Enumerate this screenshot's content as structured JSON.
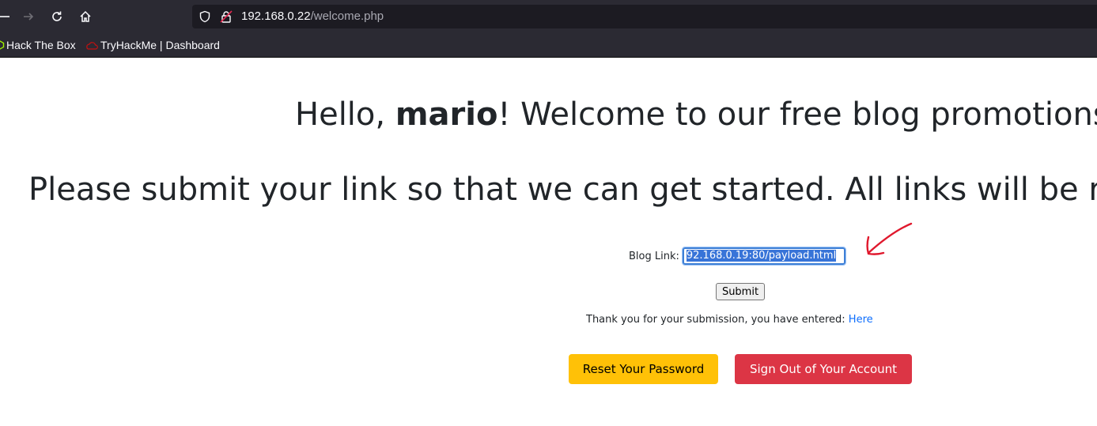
{
  "browser": {
    "url_host": "192.168.0.22",
    "url_path": "/welcome.php",
    "bookmarks": [
      {
        "label": "Hack The Box"
      },
      {
        "label": "TryHackMe | Dashboard"
      }
    ]
  },
  "page": {
    "greeting_prefix": "Hello, ",
    "username": "mario",
    "greeting_suffix": "! Welcome to our free blog promotions",
    "subheading": "Please submit your link so that we can get started. All links will be r",
    "form": {
      "label": "Blog Link:",
      "value": "92.168.0.19:80/payload.html",
      "submit_label": "Submit"
    },
    "thanks_text": "Thank you for your submission, you have entered: ",
    "thanks_link": "Here",
    "reset_button": "Reset Your Password",
    "signout_button": "Sign Out of Your Account"
  },
  "colors": {
    "chrome_bg": "#2b2a33",
    "urlbar_bg": "#1c1b22",
    "warning": "#ffc107",
    "danger": "#dc3545",
    "link": "#0d6efd",
    "annotation_arrow": "#e0182d"
  }
}
